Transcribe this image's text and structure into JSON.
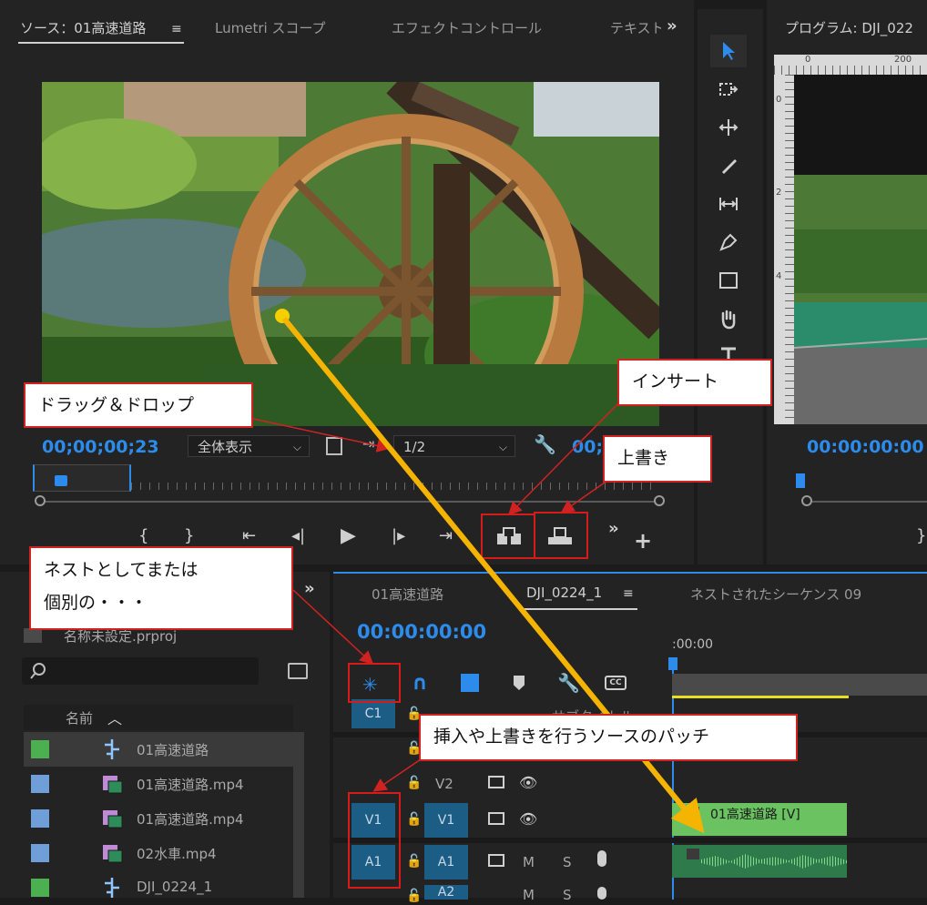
{
  "source_panel": {
    "tabs": [
      "ソース：01高速道路",
      "Lumetri スコープ",
      "エフェクトコントロール",
      "テキスト"
    ],
    "menu_icon": "hamburger-icon",
    "overflow": "»",
    "timecode": "00;00;00;23",
    "fit_select": "全体表示",
    "resolution_select": "1/2",
    "timecode_right": "00;",
    "tick_labels": []
  },
  "program_panel": {
    "title": "プログラム: DJI_022",
    "timecode": "00:00:00:00",
    "ruler_labels": [
      "0",
      "200"
    ],
    "vruler_labels": [
      "0",
      "2",
      "4"
    ]
  },
  "callouts": {
    "drag_drop": "ドラッグ＆ドロップ",
    "insert": "インサート",
    "overwrite": "上書き",
    "nest_line1": "ネストとしてまたは",
    "nest_line2": "個別の・・・",
    "patch": "挿入や上書きを行うソースのパッチ"
  },
  "project_panel": {
    "project_file": "名称未設定.prproj",
    "column_name": "名前",
    "overflow": "»",
    "items": [
      {
        "name": "01高速道路",
        "color": "#4caf50",
        "icon": "sequence-icon"
      },
      {
        "name": "01高速道路.mp4",
        "color": "#6f9ed8",
        "icon": "video-clip-icon"
      },
      {
        "name": "01高速道路.mp4",
        "color": "#6f9ed8",
        "icon": "video-clip-icon"
      },
      {
        "name": "02水車.mp4",
        "color": "#6f9ed8",
        "icon": "video-clip-icon"
      },
      {
        "name": "DJI_0224_1",
        "color": "#4caf50",
        "icon": "sequence-icon"
      }
    ]
  },
  "timeline_panel": {
    "tabs": [
      "01高速道路",
      "DJI_0224_1",
      "ネストされたシーケンス 09"
    ],
    "timecode": "00:00:00:00",
    "ruler_start": ":00:00",
    "tracks": {
      "c1": "C1",
      "v2": "V2",
      "v1_source": "V1",
      "v1_target": "V1",
      "a1_source": "A1",
      "a1_target": "A1",
      "a2": "A2",
      "mute": "M",
      "solo": "S",
      "caption_overlay": "サブタイトル"
    },
    "clip_video_label": "01高速道路 [V]"
  },
  "colors": {
    "accent_blue": "#2d8ceb",
    "callout_border": "#d12222",
    "arrow": "#f5b400",
    "clip_green": "#6ac261",
    "track_blue": "#1c5d86"
  }
}
